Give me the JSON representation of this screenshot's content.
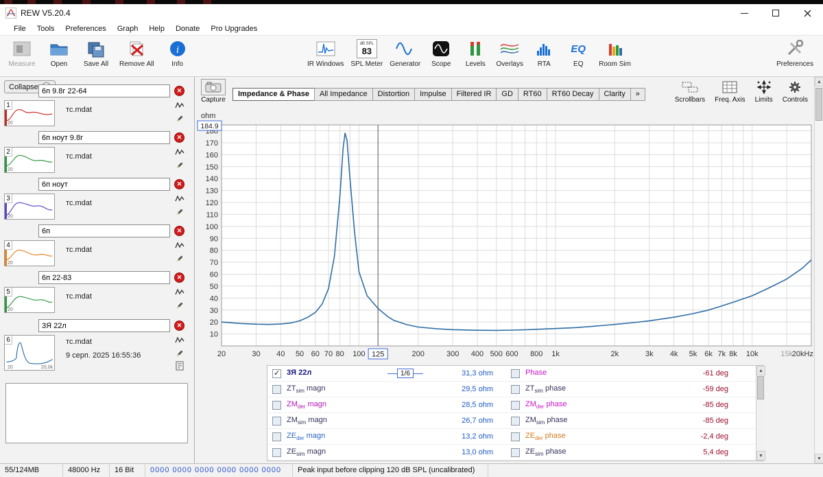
{
  "window": {
    "title": "REW V5.20.4"
  },
  "menu": {
    "items": [
      "File",
      "Tools",
      "Preferences",
      "Graph",
      "Help",
      "Donate",
      "Pro Upgrades"
    ]
  },
  "toolbar": {
    "measure": "Measure",
    "open": "Open",
    "save_all": "Save All",
    "remove_all": "Remove All",
    "info": "Info",
    "ir_windows": "IR Windows",
    "spl_meter": "SPL Meter",
    "spl_value": "83",
    "spl_unit": "dB SPL",
    "generator": "Generator",
    "scope": "Scope",
    "levels": "Levels",
    "overlays": "Overlays",
    "rta": "RTA",
    "eq": "EQ",
    "room_sim": "Room Sim",
    "preferences": "Preferences"
  },
  "sidebar": {
    "collapse": "Collapse",
    "items": [
      {
        "num": "1",
        "name": "6п 9.8г 22-64",
        "file": "тс.mdat",
        "color": "#c8281e",
        "xmin": "20"
      },
      {
        "num": "2",
        "name": "6п ноут 9.8г",
        "file": "тс.mdat",
        "color": "#2e9641",
        "xmin": "20"
      },
      {
        "num": "3",
        "name": "6п ноут",
        "file": "тс.mdat",
        "color": "#5a46c8",
        "xmin": "20"
      },
      {
        "num": "4",
        "name": "6п",
        "file": "тс.mdat",
        "color": "#e6821e",
        "xmin": "20"
      },
      {
        "num": "5",
        "name": "6п 22-83",
        "file": "тс.mdat",
        "color": "#2e9641",
        "xmin": "20"
      },
      {
        "num": "6",
        "name": "3Я 22л",
        "file": "тс.mdat",
        "date": "9 серп. 2025 16:55:36",
        "color": "#2e6da4",
        "xmin": "20",
        "xmax": "20,0k"
      }
    ]
  },
  "graph": {
    "capture": "Capture",
    "tabs": [
      "Impedance & Phase",
      "All Impedance",
      "Distortion",
      "Impulse",
      "Filtered IR",
      "GD",
      "RT60",
      "RT60 Decay",
      "Clarity",
      "»"
    ],
    "active_tab": 0,
    "buttons": [
      "Scrollbars",
      "Freq. Axis",
      "Limits",
      "Controls"
    ]
  },
  "chart_data": {
    "type": "line",
    "title": "Impedance & Phase",
    "ylabel": "ohm",
    "x_scale": "log",
    "xlim": [
      20,
      20000
    ],
    "ylim": [
      0,
      184.9
    ],
    "axis_max_label": "184.9",
    "color": "#2e6da4",
    "grid": true,
    "cursor": {
      "freq": 125,
      "freq_label": "125",
      "value": "31,3 ohm"
    },
    "x_ticks": [
      {
        "f": 20,
        "l": "20"
      },
      {
        "f": 30,
        "l": "30"
      },
      {
        "f": 40,
        "l": "40"
      },
      {
        "f": 50,
        "l": "50"
      },
      {
        "f": 60,
        "l": "60"
      },
      {
        "f": 70,
        "l": "70"
      },
      {
        "f": 80,
        "l": "80"
      },
      {
        "f": 100,
        "l": "100"
      },
      {
        "f": 200,
        "l": "200"
      },
      {
        "f": 300,
        "l": "300"
      },
      {
        "f": 400,
        "l": "400"
      },
      {
        "f": 500,
        "l": "500"
      },
      {
        "f": 600,
        "l": "600"
      },
      {
        "f": 800,
        "l": "800"
      },
      {
        "f": 1000,
        "l": "1k"
      },
      {
        "f": 2000,
        "l": "2k"
      },
      {
        "f": 3000,
        "l": "3k"
      },
      {
        "f": 4000,
        "l": "4k"
      },
      {
        "f": 5000,
        "l": "5k"
      },
      {
        "f": 6000,
        "l": "6k"
      },
      {
        "f": 7000,
        "l": "7k"
      },
      {
        "f": 8000,
        "l": "8k"
      },
      {
        "f": 10000,
        "l": "10k"
      },
      {
        "f": 15000,
        "l": "15k",
        "muted": true
      },
      {
        "f": 20000,
        "l": "20kHz"
      }
    ],
    "y_tick_step": 10,
    "y_tick_max": 180,
    "points": [
      [
        20,
        20
      ],
      [
        25,
        18.8
      ],
      [
        30,
        18.2
      ],
      [
        35,
        18
      ],
      [
        40,
        18.3
      ],
      [
        45,
        19.2
      ],
      [
        50,
        21
      ],
      [
        55,
        24
      ],
      [
        60,
        28
      ],
      [
        65,
        35
      ],
      [
        70,
        48
      ],
      [
        75,
        75
      ],
      [
        80,
        125
      ],
      [
        83,
        165
      ],
      [
        85,
        178
      ],
      [
        87,
        172
      ],
      [
        90,
        140
      ],
      [
        95,
        95
      ],
      [
        100,
        62
      ],
      [
        110,
        42
      ],
      [
        125,
        31.3
      ],
      [
        140,
        24.5
      ],
      [
        150,
        21.5
      ],
      [
        175,
        17.8
      ],
      [
        200,
        15.8
      ],
      [
        250,
        14.3
      ],
      [
        300,
        13.6
      ],
      [
        350,
        13.3
      ],
      [
        400,
        13.1
      ],
      [
        500,
        13
      ],
      [
        600,
        13.2
      ],
      [
        700,
        13.5
      ],
      [
        800,
        13.9
      ],
      [
        1000,
        14.5
      ],
      [
        1250,
        15.3
      ],
      [
        1500,
        16.2
      ],
      [
        2000,
        18
      ],
      [
        2500,
        19.5
      ],
      [
        3000,
        21
      ],
      [
        4000,
        24
      ],
      [
        5000,
        27
      ],
      [
        6000,
        30
      ],
      [
        7000,
        33.5
      ],
      [
        8000,
        36.5
      ],
      [
        10000,
        42
      ],
      [
        12000,
        48
      ],
      [
        15000,
        56
      ],
      [
        18000,
        65
      ],
      [
        20000,
        72
      ]
    ]
  },
  "legend": {
    "value_color": "#1e5ac8",
    "deg_color": "#9b1030",
    "magn_rows": [
      {
        "checked": true,
        "base": "3Я 22л",
        "sub": "",
        "suffix": "",
        "smoothing": "1/6",
        "value": "31,3 ohm",
        "label_color": "#14147a"
      },
      {
        "checked": false,
        "base": "ZT",
        "sub": "sim",
        "suffix": " magn",
        "value": "29,5 ohm",
        "label_color": "#32325a"
      },
      {
        "checked": false,
        "base": "ZM",
        "sub": "der",
        "suffix": " magn",
        "value": "28,5 ohm",
        "label_color": "#b414b4"
      },
      {
        "checked": false,
        "base": "ZM",
        "sub": "sim",
        "suffix": " magn",
        "value": "26,7 ohm",
        "label_color": "#32325a"
      },
      {
        "checked": false,
        "base": "ZE",
        "sub": "der",
        "suffix": " magn",
        "value": "13,2 ohm",
        "label_color": "#2864c8"
      },
      {
        "checked": false,
        "base": "ZE",
        "sub": "sim",
        "suffix": " magn",
        "value": "13,0 ohm",
        "label_color": "#32325a"
      }
    ],
    "phase_rows": [
      {
        "checked": false,
        "base": "Phase",
        "sub": "",
        "suffix": "",
        "value": "-61 deg",
        "label_color": "#c814c8"
      },
      {
        "checked": false,
        "base": "ZT",
        "sub": "sim",
        "suffix": " phase",
        "value": "-59 deg",
        "label_color": "#32325a"
      },
      {
        "checked": false,
        "base": "ZM",
        "sub": "der",
        "suffix": " phase",
        "value": "-85 deg",
        "label_color": "#c814c8"
      },
      {
        "checked": false,
        "base": "ZM",
        "sub": "sim",
        "suffix": " phase",
        "value": "-85 deg",
        "label_color": "#32325a"
      },
      {
        "checked": false,
        "base": "ZE",
        "sub": "der",
        "suffix": " phase",
        "value": "-2,4 deg",
        "label_color": "#d2781e"
      },
      {
        "checked": false,
        "base": "ZE",
        "sub": "sim",
        "suffix": " phase",
        "value": "5,4 deg",
        "label_color": "#32325a"
      }
    ]
  },
  "status": {
    "memory": "55/124MB",
    "rate": "48000 Hz",
    "bits": "16 Bit",
    "digits": "0000 0000  0000 0000  0000 0000",
    "message": "Peak input before clipping 120 dB SPL (uncalibrated)"
  }
}
